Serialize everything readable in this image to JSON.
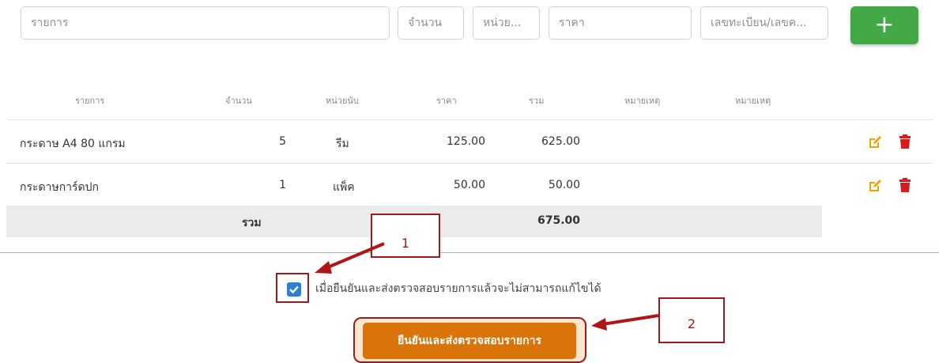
{
  "form": {
    "item_placeholder": "รายการ",
    "qty_placeholder": "จำนวน",
    "unit_placeholder": "หน่วย...",
    "price_placeholder": "ราคา",
    "ref_placeholder": "เลขทะเบียน/เลขค...",
    "add_label": "+"
  },
  "table": {
    "headers": [
      "รายการ",
      "จำนวน",
      "หน่วยนับ",
      "ราคา",
      "รวม",
      "หมายเหตุ",
      "หมายเหตุ"
    ],
    "rows": [
      {
        "item": "กระดาษ A4 80 แกรม",
        "qty": "5",
        "unit": "รีม",
        "price": "125.00",
        "total": "625.00"
      },
      {
        "item": "กระดาษการ์ดปก",
        "qty": "1",
        "unit": "แพ็ค",
        "price": "50.00",
        "total": "50.00"
      }
    ],
    "total_label": "รวม",
    "total_value": "675.00"
  },
  "confirm": {
    "checkbox_label": "เมื่อยืนยันและส่งตรวจสอบรายการแล้วจะไม่สามารถแก้ไขได้",
    "checked": true,
    "submit_label": "ยืนยันและส่งตรวจสอบรายการ"
  },
  "annotations": {
    "callout_1": "1",
    "callout_2": "2",
    "arrow_color": "#b01515"
  },
  "colors": {
    "add_button": "#43a947",
    "submit_button": "#d9740b",
    "edit_icon": "#f0a300",
    "delete_icon": "#d81b1b",
    "checkbox": "#2a7fd8"
  }
}
